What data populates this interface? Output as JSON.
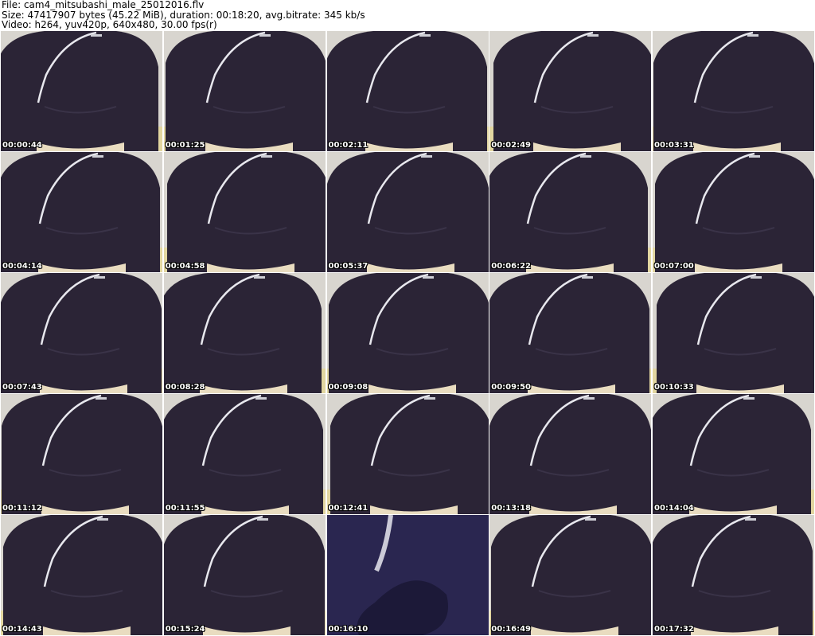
{
  "header": {
    "line1": "File: cam4_mitsubashi_male_25012016.flv",
    "line2": "Size: 47417907 bytes (45.22 MiB), duration: 00:18:20, avg.bitrate: 345 kb/s",
    "line3": "Video: h264, yuv420p, 640x480, 30.00 fps(r)"
  },
  "thumbnails": [
    {
      "time": "00:00:44"
    },
    {
      "time": "00:01:25"
    },
    {
      "time": "00:02:11"
    },
    {
      "time": "00:02:49"
    },
    {
      "time": "00:03:31"
    },
    {
      "time": "00:04:14"
    },
    {
      "time": "00:04:58"
    },
    {
      "time": "00:05:37"
    },
    {
      "time": "00:06:22"
    },
    {
      "time": "00:07:00"
    },
    {
      "time": "00:07:43"
    },
    {
      "time": "00:08:28"
    },
    {
      "time": "00:09:08"
    },
    {
      "time": "00:09:50"
    },
    {
      "time": "00:10:33"
    },
    {
      "time": "00:11:12"
    },
    {
      "time": "00:11:55"
    },
    {
      "time": "00:12:41"
    },
    {
      "time": "00:13:18"
    },
    {
      "time": "00:14:04"
    },
    {
      "time": "00:14:43"
    },
    {
      "time": "00:15:24"
    },
    {
      "time": "00:16:10"
    },
    {
      "time": "00:16:49"
    },
    {
      "time": "00:17:32"
    }
  ],
  "colors": {
    "shirt": "#2b2436",
    "wall": "#d8d5cf",
    "chair": "#9a6a3a",
    "floor": "#e2d6a0",
    "stripe": "#e8e8ee"
  }
}
